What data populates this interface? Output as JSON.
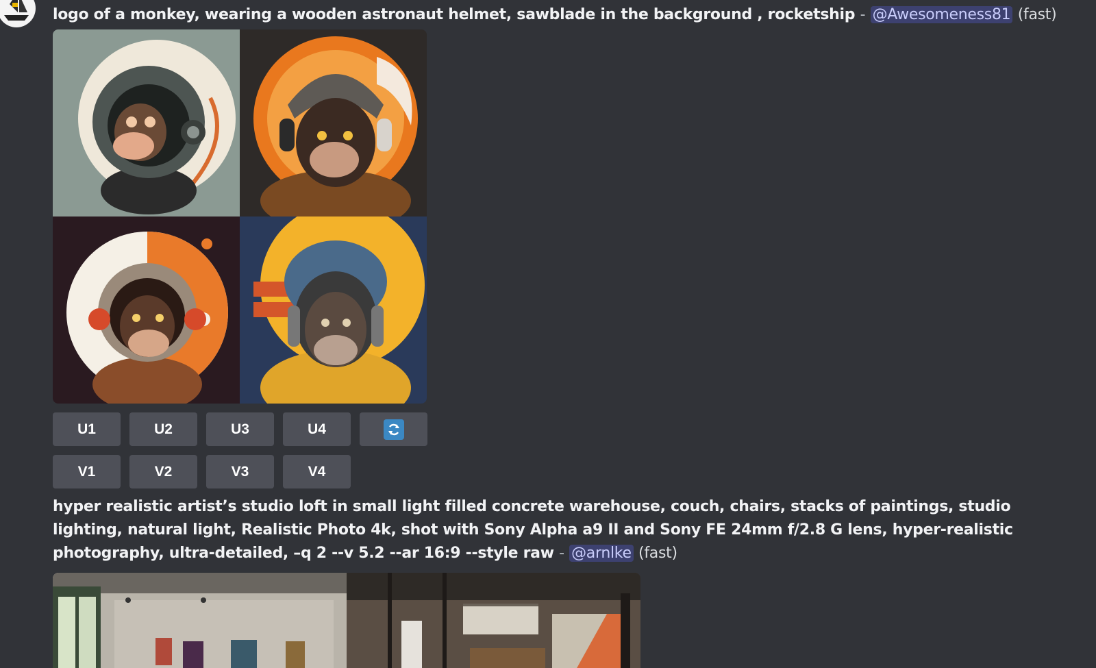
{
  "messages": [
    {
      "prompt": "logo of a monkey, wearing a wooden astronaut helmet, sawblade in the background , rocketship",
      "separator": "-",
      "mention": "@Awesomeness81",
      "mode": "(fast)",
      "images": [
        {
          "icon": "monkey-astronaut-grey-icon"
        },
        {
          "icon": "monkey-astronaut-orange-icon"
        },
        {
          "icon": "monkey-astronaut-moon-icon"
        },
        {
          "icon": "monkey-astronaut-yellow-icon"
        }
      ],
      "upscale_buttons": [
        "U1",
        "U2",
        "U3",
        "U4"
      ],
      "reroll_icon": "refresh-icon",
      "variation_buttons": [
        "V1",
        "V2",
        "V3",
        "V4"
      ]
    },
    {
      "prompt": "hyper realistic artist’s studio loft in small light filled concrete warehouse, couch, chairs, stacks of paintings, studio lighting, natural light, Realistic Photo 4k, shot with Sony Alpha a9 II and Sony FE 24mm f/2.8 G lens, hyper-realistic photography, ultra-detailed, –q 2 --v 5.2 --ar 16:9 --style raw",
      "separator": "-",
      "mention": "@arnlke",
      "mode": "(fast)"
    }
  ],
  "colors": {
    "background": "#313338",
    "button": "#4e5058",
    "mention_bg": "#3c4270",
    "mention_text": "#c9cdfb",
    "refresh": "#3b88c3"
  }
}
